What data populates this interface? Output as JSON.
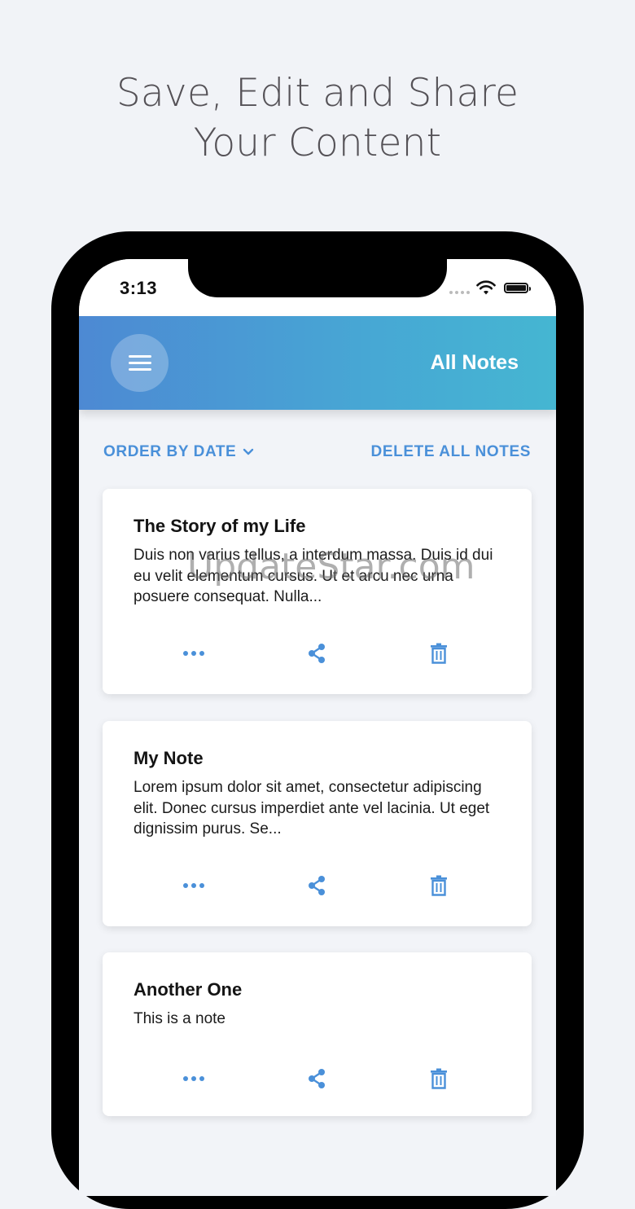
{
  "headline": {
    "line1": "Save, Edit and Share",
    "line2": "Your Content"
  },
  "status_bar": {
    "time": "3:13"
  },
  "header": {
    "title": "All Notes",
    "menu_icon": "hamburger-menu-icon"
  },
  "toolbar": {
    "order_label": "ORDER BY DATE",
    "delete_all_label": "DELETE ALL NOTES"
  },
  "notes": [
    {
      "title": "The Story of my Life",
      "body": "Duis non varius tellus, a interdum massa. Duis id dui eu velit elementum cursus. Ut et arcu nec urna posuere consequat. Nulla..."
    },
    {
      "title": "My Note",
      "body": "Lorem ipsum dolor sit amet, consectetur adipiscing elit. Donec cursus imperdiet ante vel lacinia. Ut eget dignissim purus. Se..."
    },
    {
      "title": "Another One",
      "body": "This is a note"
    }
  ],
  "watermark": "UpdateStar.com",
  "colors": {
    "accent": "#4a90d9",
    "header_start": "#4d89d3",
    "header_end": "#45b6d2",
    "background": "#f1f3f7"
  }
}
